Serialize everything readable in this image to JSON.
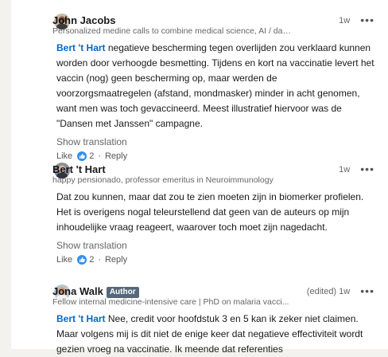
{
  "comments": [
    {
      "name": "John Jacobs",
      "headline": "Personalized medine calls to combine medical science, AI / data scienc...",
      "time": "1w",
      "mention": "Bert 't Hart",
      "text": " negatieve bescherming tegen overlijden zou verklaard kunnen worden door verhoogde besmetting. Tijdens en kort na vaccinatie levert het vaccin (nog) geen bescherming op, maar werden de voorzorgsmaatregelen (afstand, mondmasker) minder in acht genomen, want men was toch gevaccineerd. Meest illustratief hiervoor was de \"Dansen met Janssen\" campagne.",
      "translate": "Show translation",
      "like": "Like",
      "reactions": "2",
      "reply": "Reply"
    },
    {
      "name": "Bert 't Hart",
      "headline": "happy pensionado, professor emeritus in Neuroimmunology",
      "time": "1w",
      "text": "Dat zou kunnen, maar dat zou te zien moeten zijn in biomerker profielen. Het is overigens nogal teleurstellend dat geen van de auteurs op mijn inhoudelijke vraag reageert, waarover toch moet zijn nagedacht.",
      "translate": "Show translation",
      "like": "Like",
      "reactions": "2",
      "reply": "Reply"
    },
    {
      "name": "Jona Walk",
      "badge": "Author",
      "headline": "Fellow internal medicine-intensive care | PhD on malaria vacci...",
      "time": "(edited) 1w",
      "mention": "Bert 't Hart",
      "text": " Nee, credit voor hoofdstuk 3 en 5 kan ik zeker niet claimen. Maar volgens mij is dit niet de enige keer dat negatieve effectiviteit wordt gezien vroeg na vaccinatie. Ik meende dat referenties"
    }
  ],
  "colors": {
    "link": "#0a66c2",
    "badge": "#56687a",
    "reaction": "#378fe9"
  },
  "icons": [
    "avatar-john",
    "avatar-bert",
    "avatar-jona",
    "overflow-dots-icon",
    "like-reaction-icon"
  ]
}
